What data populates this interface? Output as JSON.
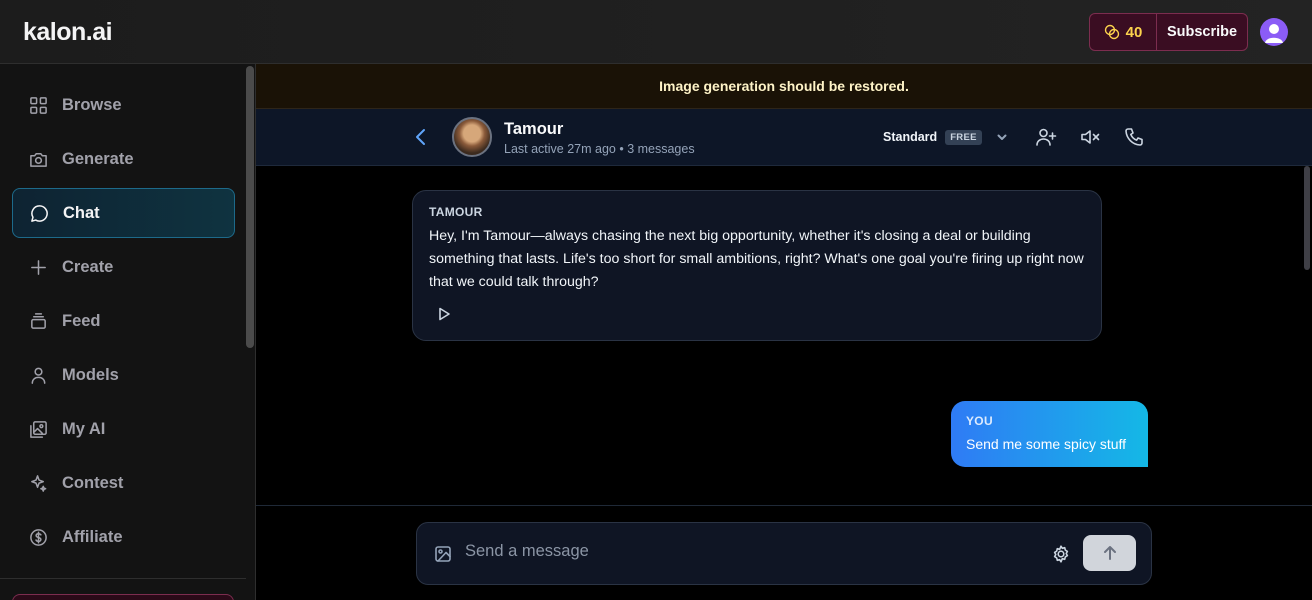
{
  "app": {
    "logo_text": "kalon.ai"
  },
  "topbar": {
    "credits": "40",
    "credits_icon": "coins-icon",
    "subscribe_label": "Subscribe",
    "avatar_icon": "user-avatar-icon"
  },
  "sidebar": {
    "items": [
      {
        "label": "Browse",
        "icon": "grid-icon",
        "active": false
      },
      {
        "label": "Generate",
        "icon": "camera-icon",
        "active": false
      },
      {
        "label": "Chat",
        "icon": "chat-bubble-icon",
        "active": true
      },
      {
        "label": "Create",
        "icon": "plus-icon",
        "active": false
      },
      {
        "label": "Feed",
        "icon": "layers-icon",
        "active": false
      },
      {
        "label": "Models",
        "icon": "person-icon",
        "active": false
      },
      {
        "label": "My AI",
        "icon": "images-icon",
        "active": false
      },
      {
        "label": "Contest",
        "icon": "sparkles-icon",
        "active": false
      },
      {
        "label": "Affiliate",
        "icon": "dollar-circle-icon",
        "active": false
      }
    ]
  },
  "notice": {
    "text": "Image generation should be restored."
  },
  "chat_header": {
    "name": "Tamour",
    "meta": "Last active 27m ago • 3 messages",
    "model_name": "Standard",
    "model_badge": "FREE"
  },
  "messages": [
    {
      "sender": "TAMOUR",
      "text": "Hey, I'm Tamour—always chasing the next big opportunity, whether it's closing a deal or building something that lasts. Life's too short for small ambitions, right? What's one goal you're firing up right now that we could talk through?",
      "from": "bot"
    },
    {
      "sender": "YOU",
      "text": "Send me some spicy stuff",
      "from": "user"
    }
  ],
  "composer": {
    "placeholder": "Send a message",
    "value": ""
  },
  "colors": {
    "accent_blue": "#2f7bf5",
    "accent_cyan": "#14b8e6",
    "subscribe_bg": "#3a0d22",
    "credits_gold": "#fcd34d"
  }
}
